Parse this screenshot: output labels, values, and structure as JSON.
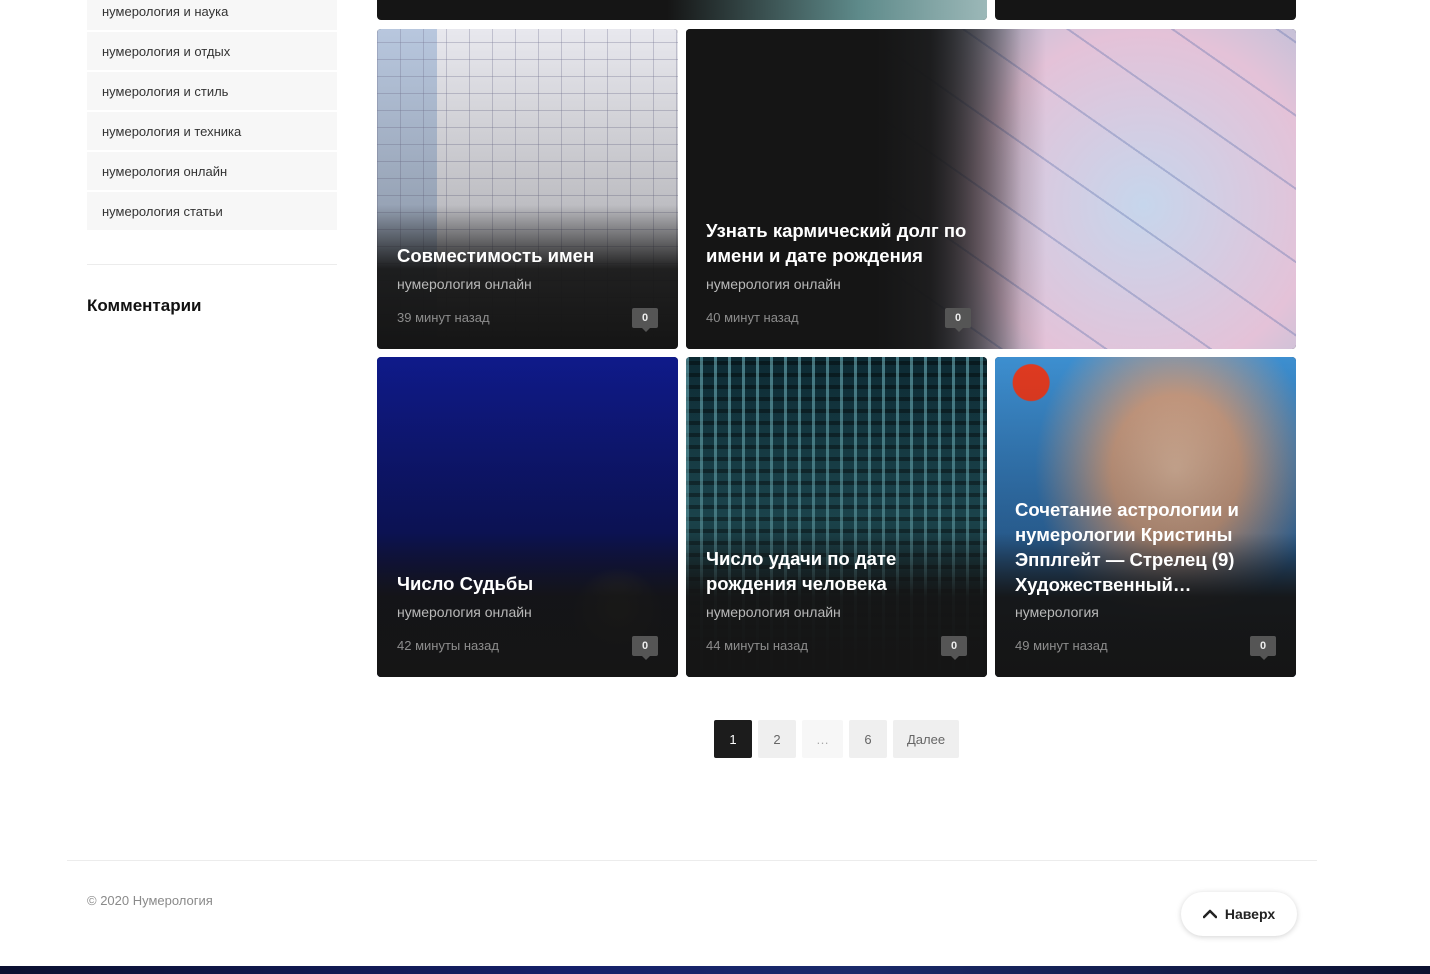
{
  "sidebar": {
    "items": [
      {
        "label": "нумерология и наука"
      },
      {
        "label": "нумерология и отдых"
      },
      {
        "label": "нумерология и стиль"
      },
      {
        "label": "нумерология и техника"
      },
      {
        "label": "нумерология онлайн"
      },
      {
        "label": "нумерология статьи"
      }
    ],
    "comments_heading": "Комментарии"
  },
  "cards": [
    {
      "title": "Совместимость имен",
      "category": "нумерология онлайн",
      "time": "39 минут назад",
      "comments": "0"
    },
    {
      "title": "Узнать кармический долг по имени и дате рождения",
      "category": "нумерология онлайн",
      "time": "40 минут назад",
      "comments": "0"
    },
    {
      "title": "Число Судьбы",
      "category": "нумерология онлайн",
      "time": "42 минуты назад",
      "comments": "0"
    },
    {
      "title": "Число удачи по дате рождения человека",
      "category": "нумерология онлайн",
      "time": "44 минуты назад",
      "comments": "0"
    },
    {
      "title": "Сочетание астрологии и нумерологии Кристины Эпплгейт — Стрелец (9) Художественный…",
      "category": "нумерология",
      "time": "49 минут назад",
      "comments": "0"
    }
  ],
  "card_images": {
    "card1": "numerology-table-image",
    "card2": "astrology-wheel-image",
    "card3": "destiny-number-slide-image",
    "card4": "matrix-digits-image",
    "card5": "magazine-cover-woman-image"
  },
  "pagination": {
    "pages": [
      "1",
      "2",
      "…",
      "6"
    ],
    "next": "Далее",
    "current": "1"
  },
  "footer": {
    "copyright": "© 2020 Нумерология",
    "to_top": "Наверх"
  }
}
